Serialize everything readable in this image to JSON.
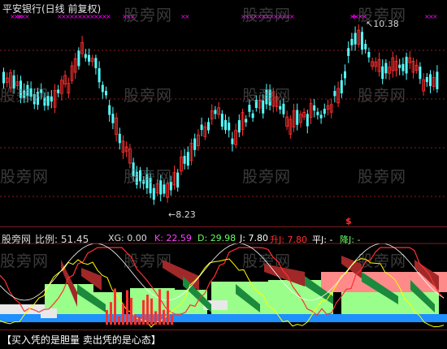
{
  "main": {
    "title": "平安银行(日线 前复权)",
    "high_label": "10.38",
    "low_label": "8.23",
    "signal_glyph": "$",
    "colors": {
      "up": "#ff3030",
      "down": "#54ffff",
      "marker": "#ff00ff"
    }
  },
  "watermark": {
    "text": "股旁网"
  },
  "sub": {
    "site": "股旁网",
    "ratio_label": "比例:",
    "ratio_value": "51.45",
    "xg_label": "XG:",
    "xg_value": "0.00",
    "k_label": "K:",
    "k_value": "22.59",
    "d_label": "D:",
    "d_value": "29.98",
    "j_label": "J:",
    "j_value": "7.80",
    "up_label": "升J:",
    "up_value": "7.80",
    "flat_label": "平J:",
    "flat_value": "-",
    "down_label": "降J:",
    "down_value": "-",
    "colors": {
      "k": "#ff40ff",
      "d": "#66ff66",
      "j": "#ffffff",
      "up": "#ff3030",
      "down": "#66ff66"
    }
  },
  "footer": {
    "text": "【买入凭的是胆量 卖出凭的是心态】"
  }
}
